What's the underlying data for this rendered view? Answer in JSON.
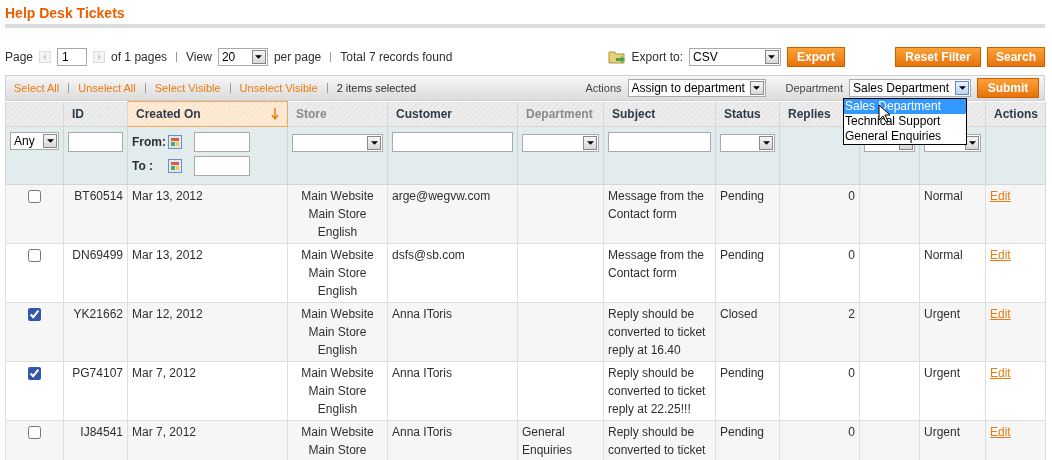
{
  "page_title": "Help Desk Tickets",
  "pager": {
    "page_label": "Page",
    "page": "1",
    "of_pages": "of 1 pages",
    "view_label": "View",
    "per_page": "20",
    "per_page_label": "per page",
    "total": "Total 7 records found"
  },
  "export": {
    "label": "Export to:",
    "format": "CSV",
    "button": "Export"
  },
  "buttons": [
    "Reset Filter",
    "Search"
  ],
  "massaction": {
    "links": [
      "Select All",
      "Unselect All",
      "Select Visible",
      "Unselect Visible"
    ],
    "selected_count": "2 items selected",
    "actions_label": "Actions",
    "action": "Assign to department",
    "department_label": "Department",
    "department": "Sales Department",
    "submit": "Submit",
    "department_dropdown": {
      "expanded": true,
      "options": [
        {
          "label": "Sales Department",
          "selected": true
        },
        {
          "label": "Technical Support",
          "selected": false
        },
        {
          "label": "General Enquiries",
          "selected": false
        }
      ]
    }
  },
  "table": {
    "columns": [
      {
        "filter": {
          "kind": "select",
          "value": "Any"
        }
      },
      {
        "label": "ID",
        "sortable": true,
        "sorted": false,
        "filter": {
          "kind": "text"
        }
      },
      {
        "label": "Created On",
        "sortable": true,
        "sorted": true,
        "filter": {
          "kind": "daterange",
          "from_label": "From:",
          "to_label": "To :"
        }
      },
      {
        "label": "Store",
        "sortable": false,
        "sorted": false,
        "filter": {
          "kind": "select"
        }
      },
      {
        "label": "Customer",
        "sortable": true,
        "sorted": false,
        "filter": {
          "kind": "text"
        }
      },
      {
        "label": "Department",
        "sortable": false,
        "sorted": false,
        "filter": {
          "kind": "select"
        }
      },
      {
        "label": "Subject",
        "sortable": true,
        "sorted": false,
        "filter": {
          "kind": "text"
        }
      },
      {
        "label": "Status",
        "sortable": true,
        "sorted": false,
        "filter": {
          "kind": "select"
        }
      },
      {
        "label": "Replies",
        "sortable": true,
        "sorted": false
      },
      {
        "filter": {
          "kind": "select"
        }
      },
      {
        "filter": {
          "kind": "select"
        }
      },
      {
        "label": "Actions",
        "sortable": true,
        "sorted": false
      }
    ],
    "rows": [
      {
        "selected": false,
        "id": "BT60514",
        "created": "Mar 13, 2012",
        "store": "Main Website\nMain Store\nEnglish",
        "customer": "arge@wegvw.com",
        "subject": "Message from the Contact form",
        "status": "Pending",
        "replies": "0",
        "column_11": "Normal",
        "action": "Edit"
      },
      {
        "selected": false,
        "id": "DN69499",
        "created": "Mar 13, 2012",
        "store": "Main Website\nMain Store\nEnglish",
        "customer": "dsfs@sb.com",
        "subject": "Message from the Contact form",
        "status": "Pending",
        "replies": "0",
        "column_11": "Normal",
        "action": "Edit"
      },
      {
        "selected": true,
        "id": "YK21662",
        "created": "Mar 12, 2012",
        "store": "Main Website\nMain Store\nEnglish",
        "customer": "Anna IToris",
        "subject": "Reply should be converted to ticket reply at 16.40",
        "status": "Closed",
        "replies": "2",
        "column_11": "Urgent",
        "action": "Edit"
      },
      {
        "selected": true,
        "id": "PG74107",
        "created": "Mar 7, 2012",
        "store": "Main Website\nMain Store\nEnglish",
        "customer": "Anna IToris",
        "subject": "Reply should be converted to ticket reply at 22.25!!!",
        "status": "Pending",
        "replies": "0",
        "column_11": "Urgent",
        "action": "Edit"
      },
      {
        "selected": false,
        "id": "IJ84541",
        "created": "Mar 7, 2012",
        "store": "Main Website\nMain Store",
        "customer": "Anna IToris",
        "department": "General Enquiries",
        "subject": "Reply should be converted to ticket",
        "status": "Pending",
        "replies": "0",
        "column_11": "Urgent",
        "action": "Edit"
      }
    ]
  }
}
